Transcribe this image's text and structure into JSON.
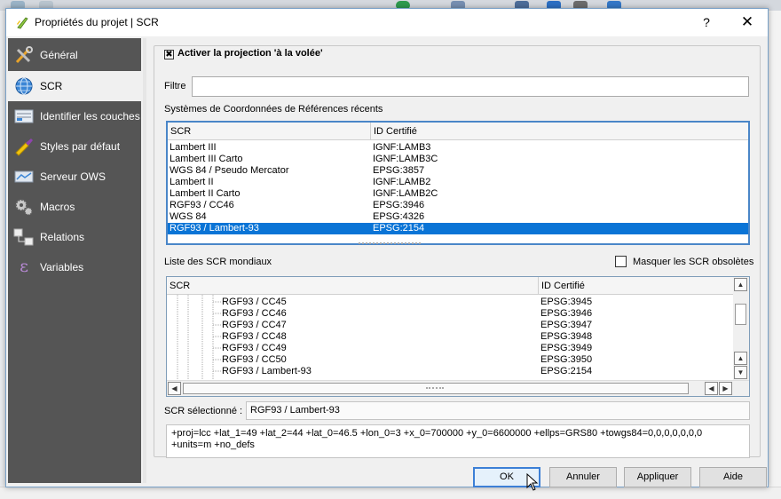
{
  "window": {
    "title": "Propriétés du projet | SCR",
    "help_label": "?",
    "close_label": "✕"
  },
  "sidebar": {
    "items": [
      {
        "label": "Général",
        "icon": "tools-icon"
      },
      {
        "label": "SCR",
        "icon": "globe-icon"
      },
      {
        "label": "Identifier les couches",
        "icon": "identify-layers-icon"
      },
      {
        "label": "Styles par défaut",
        "icon": "brush-icon"
      },
      {
        "label": "Serveur OWS",
        "icon": "server-icon"
      },
      {
        "label": "Macros",
        "icon": "gears-icon"
      },
      {
        "label": "Relations",
        "icon": "relations-icon"
      },
      {
        "label": "Variables",
        "icon": "epsilon-icon"
      }
    ],
    "active_index": 1
  },
  "projection": {
    "legend": "Activer la projection 'à la volée'",
    "checked": true,
    "check_mark": "✖"
  },
  "filter": {
    "label": "Filtre",
    "value": ""
  },
  "recent": {
    "label": "Systèmes de Coordonnées de Références récents",
    "columns": [
      "SCR",
      "ID Certifié"
    ],
    "rows": [
      {
        "scr": "Lambert III",
        "id": "IGNF:LAMB3"
      },
      {
        "scr": "Lambert III Carto",
        "id": "IGNF:LAMB3C"
      },
      {
        "scr": "WGS 84 / Pseudo Mercator",
        "id": "EPSG:3857"
      },
      {
        "scr": "Lambert II",
        "id": "IGNF:LAMB2"
      },
      {
        "scr": "Lambert II Carto",
        "id": "IGNF:LAMB2C"
      },
      {
        "scr": "RGF93 / CC46",
        "id": "EPSG:3946"
      },
      {
        "scr": "WGS 84",
        "id": "EPSG:4326"
      },
      {
        "scr": "RGF93 / Lambert-93",
        "id": "EPSG:2154"
      }
    ],
    "selected_index": 7
  },
  "world": {
    "label": "Liste des SCR mondiaux",
    "hide_obsolete_label": "Masquer les SCR obsolètes",
    "hide_obsolete_checked": false,
    "columns": [
      "SCR",
      "ID Certifié"
    ],
    "rows": [
      {
        "scr": "RGF93 / CC45",
        "id": "EPSG:3945"
      },
      {
        "scr": "RGF93 / CC46",
        "id": "EPSG:3946"
      },
      {
        "scr": "RGF93 / CC47",
        "id": "EPSG:3947"
      },
      {
        "scr": "RGF93 / CC48",
        "id": "EPSG:3948"
      },
      {
        "scr": "RGF93 / CC49",
        "id": "EPSG:3949"
      },
      {
        "scr": "RGF93 / CC50",
        "id": "EPSG:3950"
      },
      {
        "scr": "RGF93 / Lambert-93",
        "id": "EPSG:2154"
      }
    ]
  },
  "selected": {
    "label": "SCR sélectionné :",
    "value": "RGF93 / Lambert-93",
    "proj_string": "+proj=lcc +lat_1=49 +lat_2=44 +lat_0=46.5 +lon_0=3 +x_0=700000 +y_0=6600000 +ellps=GRS80 +towgs84=0,0,0,0,0,0,0 +units=m +no_defs"
  },
  "buttons": {
    "ok": "OK",
    "cancel": "Annuler",
    "apply": "Appliquer",
    "help": "Aide"
  },
  "colors": {
    "selection": "#0a74d6",
    "sidebar_bg": "#555555",
    "focus_border": "#3c7fd6"
  }
}
